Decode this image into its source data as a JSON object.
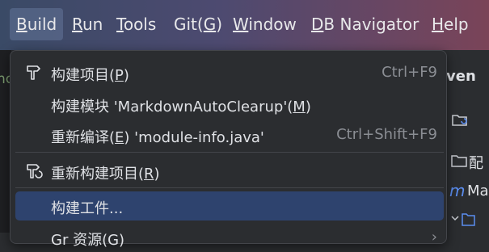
{
  "menubar": {
    "items": [
      {
        "text": "Build",
        "mnemonic": "B",
        "rest": "uild"
      },
      {
        "text": "Run",
        "mnemonic": "R",
        "rest": "un"
      },
      {
        "text": "Tools",
        "mnemonic": "T",
        "rest": "ools"
      },
      {
        "text": "Git(G)",
        "pre": "Git(",
        "mnemonic": "G",
        "post": ")"
      },
      {
        "text": "Window",
        "mnemonic": "W",
        "rest": "indow"
      },
      {
        "text": "DB Navigator",
        "mnemonic": "D",
        "rest": "B Navigator"
      },
      {
        "text": "Help",
        "mnemonic": "H",
        "rest": "elp"
      }
    ]
  },
  "left_fragment": "nc",
  "right_panel": {
    "title": "ven",
    "row1": "配",
    "row2": "Ma"
  },
  "dropdown": {
    "items": [
      {
        "pre": "构建项目(",
        "mn": "P",
        "post": ")",
        "shortcut": "Ctrl+F9",
        "icon": "build-hammer-icon"
      },
      {
        "pre": "构建模块 'MarkdownAutoClearup'(",
        "mn": "M",
        "post": ")",
        "shortcut": ""
      },
      {
        "pre": "重新编译(",
        "mn": "E",
        "post": ") 'module-info.java'",
        "shortcut": "Ctrl+Shift+F9"
      },
      {
        "pre": "重新构建项目(",
        "mn": "R",
        "post": ")",
        "shortcut": "",
        "icon": "rebuild-icon"
      },
      {
        "pre": "构建工件...",
        "mn": "",
        "post": "",
        "shortcut": ""
      },
      {
        "pre": "Gr",
        "mn": "",
        "post": "  资源(G)",
        "shortcut": ""
      }
    ]
  }
}
